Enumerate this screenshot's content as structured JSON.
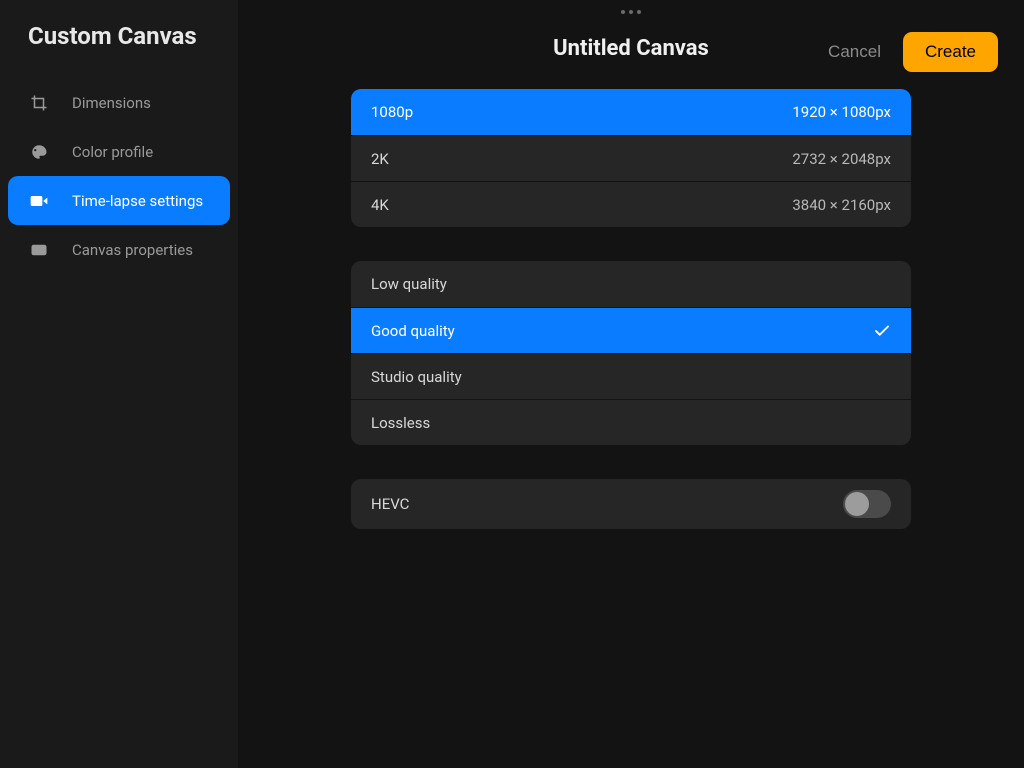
{
  "sidebar": {
    "title": "Custom Canvas",
    "items": [
      {
        "label": "Dimensions"
      },
      {
        "label": "Color profile"
      },
      {
        "label": "Time-lapse settings"
      },
      {
        "label": "Canvas properties"
      }
    ]
  },
  "header": {
    "title": "Untitled Canvas",
    "cancel": "Cancel",
    "create": "Create"
  },
  "resolutions": [
    {
      "label": "1080p",
      "value": "1920 × 1080px",
      "selected": true
    },
    {
      "label": "2K",
      "value": "2732 × 2048px",
      "selected": false
    },
    {
      "label": "4K",
      "value": "3840 × 2160px",
      "selected": false
    }
  ],
  "qualities": [
    {
      "label": "Low quality",
      "selected": false
    },
    {
      "label": "Good quality",
      "selected": true
    },
    {
      "label": "Studio quality",
      "selected": false
    },
    {
      "label": "Lossless",
      "selected": false
    }
  ],
  "hevc": {
    "label": "HEVC",
    "enabled": false
  },
  "colors": {
    "accent": "#0a7cff",
    "create_button": "#ffa500"
  }
}
